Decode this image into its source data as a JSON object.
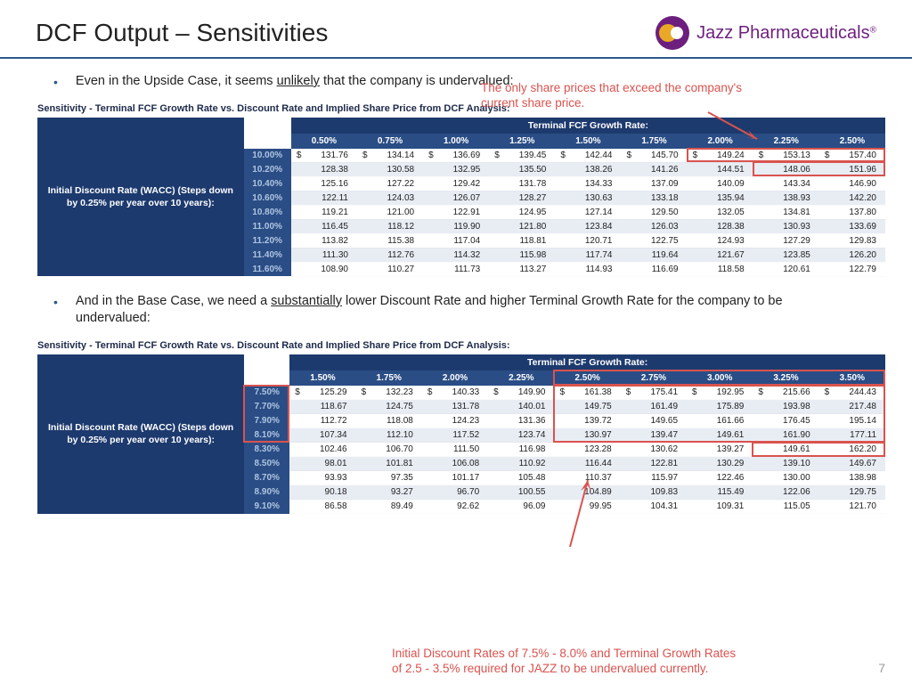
{
  "header": {
    "title": "DCF Output – Sensitivities",
    "brand": "Jazz Pharmaceuticals"
  },
  "bullets": {
    "b1_pre": "Even in the Upside Case, it seems ",
    "b1_u": "unlikely",
    "b1_post": " that the company is undervalued:",
    "b2_pre": "And in the Base Case, we need a ",
    "b2_u": "substantially",
    "b2_post": " lower Discount Rate and higher Terminal Growth Rate for the company to be undervalued:"
  },
  "tables": {
    "title": "Sensitivity - Terminal FCF Growth Rate vs. Discount Rate and Implied Share Price from DCF Analysis:",
    "group_header": "Terminal FCF Growth Rate:",
    "side_label": "Initial Discount Rate (WACC) (Steps down by 0.25% per year over 10 years):"
  },
  "annotations": {
    "a1": "The only share prices that exceed the company's current share price.",
    "a2": "Initial Discount Rates of 7.5% - 8.0% and Terminal Growth Rates of 2.5 - 3.5% required for JAZZ to be undervalued currently."
  },
  "page_number": "7",
  "chart_data": [
    {
      "type": "table",
      "title": "Upside Case sensitivity — implied share price ($)",
      "row_label": "Initial Discount Rate (WACC)",
      "col_label": "Terminal FCF Growth Rate",
      "cols": [
        "0.50%",
        "0.75%",
        "1.00%",
        "1.25%",
        "1.50%",
        "1.75%",
        "2.00%",
        "2.25%",
        "2.50%"
      ],
      "rows": [
        "10.00%",
        "10.20%",
        "10.40%",
        "10.60%",
        "10.80%",
        "11.00%",
        "11.20%",
        "11.40%",
        "11.60%"
      ],
      "values": [
        [
          131.76,
          134.14,
          136.69,
          139.45,
          142.44,
          145.7,
          149.24,
          153.13,
          157.4
        ],
        [
          128.38,
          130.58,
          132.95,
          135.5,
          138.26,
          141.26,
          144.51,
          148.06,
          151.96
        ],
        [
          125.16,
          127.22,
          129.42,
          131.78,
          134.33,
          137.09,
          140.09,
          143.34,
          146.9
        ],
        [
          122.11,
          124.03,
          126.07,
          128.27,
          130.63,
          133.18,
          135.94,
          138.93,
          142.2
        ],
        [
          119.21,
          121.0,
          122.91,
          124.95,
          127.14,
          129.5,
          132.05,
          134.81,
          137.8
        ],
        [
          116.45,
          118.12,
          119.9,
          121.8,
          123.84,
          126.03,
          128.38,
          130.93,
          133.69
        ],
        [
          113.82,
          115.38,
          117.04,
          118.81,
          120.71,
          122.75,
          124.93,
          127.29,
          129.83
        ],
        [
          111.3,
          112.76,
          114.32,
          115.98,
          117.74,
          119.64,
          121.67,
          123.85,
          126.2
        ],
        [
          108.9,
          110.27,
          111.73,
          113.27,
          114.93,
          116.69,
          118.58,
          120.61,
          122.79
        ]
      ],
      "highlight": "Cells ≥ current share price: row 10.00% cols 2.00–2.50%; row 10.20% cols 2.25–2.50%"
    },
    {
      "type": "table",
      "title": "Base Case sensitivity — implied share price ($)",
      "row_label": "Initial Discount Rate (WACC)",
      "col_label": "Terminal FCF Growth Rate",
      "cols": [
        "1.50%",
        "1.75%",
        "2.00%",
        "2.25%",
        "2.50%",
        "2.75%",
        "3.00%",
        "3.25%",
        "3.50%"
      ],
      "rows": [
        "7.50%",
        "7.70%",
        "7.90%",
        "8.10%",
        "8.30%",
        "8.50%",
        "8.70%",
        "8.90%",
        "9.10%"
      ],
      "values": [
        [
          125.29,
          132.23,
          140.33,
          149.9,
          161.38,
          175.41,
          192.95,
          215.66,
          244.43
        ],
        [
          118.67,
          124.75,
          131.78,
          140.01,
          149.75,
          161.49,
          175.89,
          193.98,
          217.48
        ],
        [
          112.72,
          118.08,
          124.23,
          131.36,
          139.72,
          149.65,
          161.66,
          176.45,
          195.14
        ],
        [
          107.34,
          112.1,
          117.52,
          123.74,
          130.97,
          139.47,
          149.61,
          161.9,
          177.11
        ],
        [
          102.46,
          106.7,
          111.5,
          116.98,
          123.28,
          130.62,
          139.27,
          149.61,
          162.2
        ],
        [
          98.01,
          101.81,
          106.08,
          110.92,
          116.44,
          122.81,
          130.29,
          139.1,
          149.67
        ],
        [
          93.93,
          97.35,
          101.17,
          105.48,
          110.37,
          115.97,
          122.46,
          130.0,
          138.98
        ],
        [
          90.18,
          93.27,
          96.7,
          100.55,
          104.89,
          109.83,
          115.49,
          122.06,
          129.75
        ],
        [
          86.58,
          89.49,
          92.62,
          96.09,
          99.95,
          104.31,
          109.31,
          115.05,
          121.7
        ]
      ],
      "highlight": "Rows 7.50–8.10% with cols 2.50–3.50% boxed; row 8.30% cols 3.25–3.50% boxed"
    }
  ]
}
